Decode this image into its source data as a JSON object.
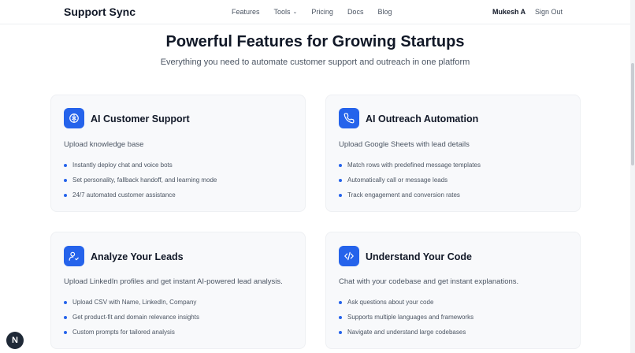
{
  "brand": "Support Sync",
  "nav": {
    "links": [
      "Features",
      "Tools",
      "Pricing",
      "Docs",
      "Blog"
    ],
    "tools_chevron": "chevron-down-icon",
    "user": "Mukesh A",
    "signout": "Sign Out"
  },
  "hero": {
    "title": "Powerful Features for Growing Startups",
    "subtitle": "Everything you need to automate customer support and outreach in one platform"
  },
  "accent_color": "#2563eb",
  "cards": [
    {
      "icon": "brain-icon",
      "title": "AI Customer Support",
      "description": "Upload knowledge base",
      "bullets": [
        "Instantly deploy chat and voice bots",
        "Set personality, fallback handoff, and learning mode",
        "24/7 automated customer assistance"
      ]
    },
    {
      "icon": "phone-icon",
      "title": "AI Outreach Automation",
      "description": "Upload Google Sheets with lead details",
      "bullets": [
        "Match rows with predefined message templates",
        "Automatically call or message leads",
        "Track engagement and conversion rates"
      ]
    },
    {
      "icon": "user-check-icon",
      "title": "Analyze Your Leads",
      "description": "Upload LinkedIn profiles and get instant AI-powered lead analysis.",
      "bullets": [
        "Upload CSV with Name, LinkedIn, Company",
        "Get product-fit and domain relevance insights",
        "Custom prompts for tailored analysis"
      ]
    },
    {
      "icon": "code-icon",
      "title": "Understand Your Code",
      "description": "Chat with your codebase and get instant explanations.",
      "bullets": [
        "Ask questions about your code",
        "Supports multiple languages and frameworks",
        "Navigate and understand large codebases"
      ]
    }
  ],
  "fab_label": "N"
}
